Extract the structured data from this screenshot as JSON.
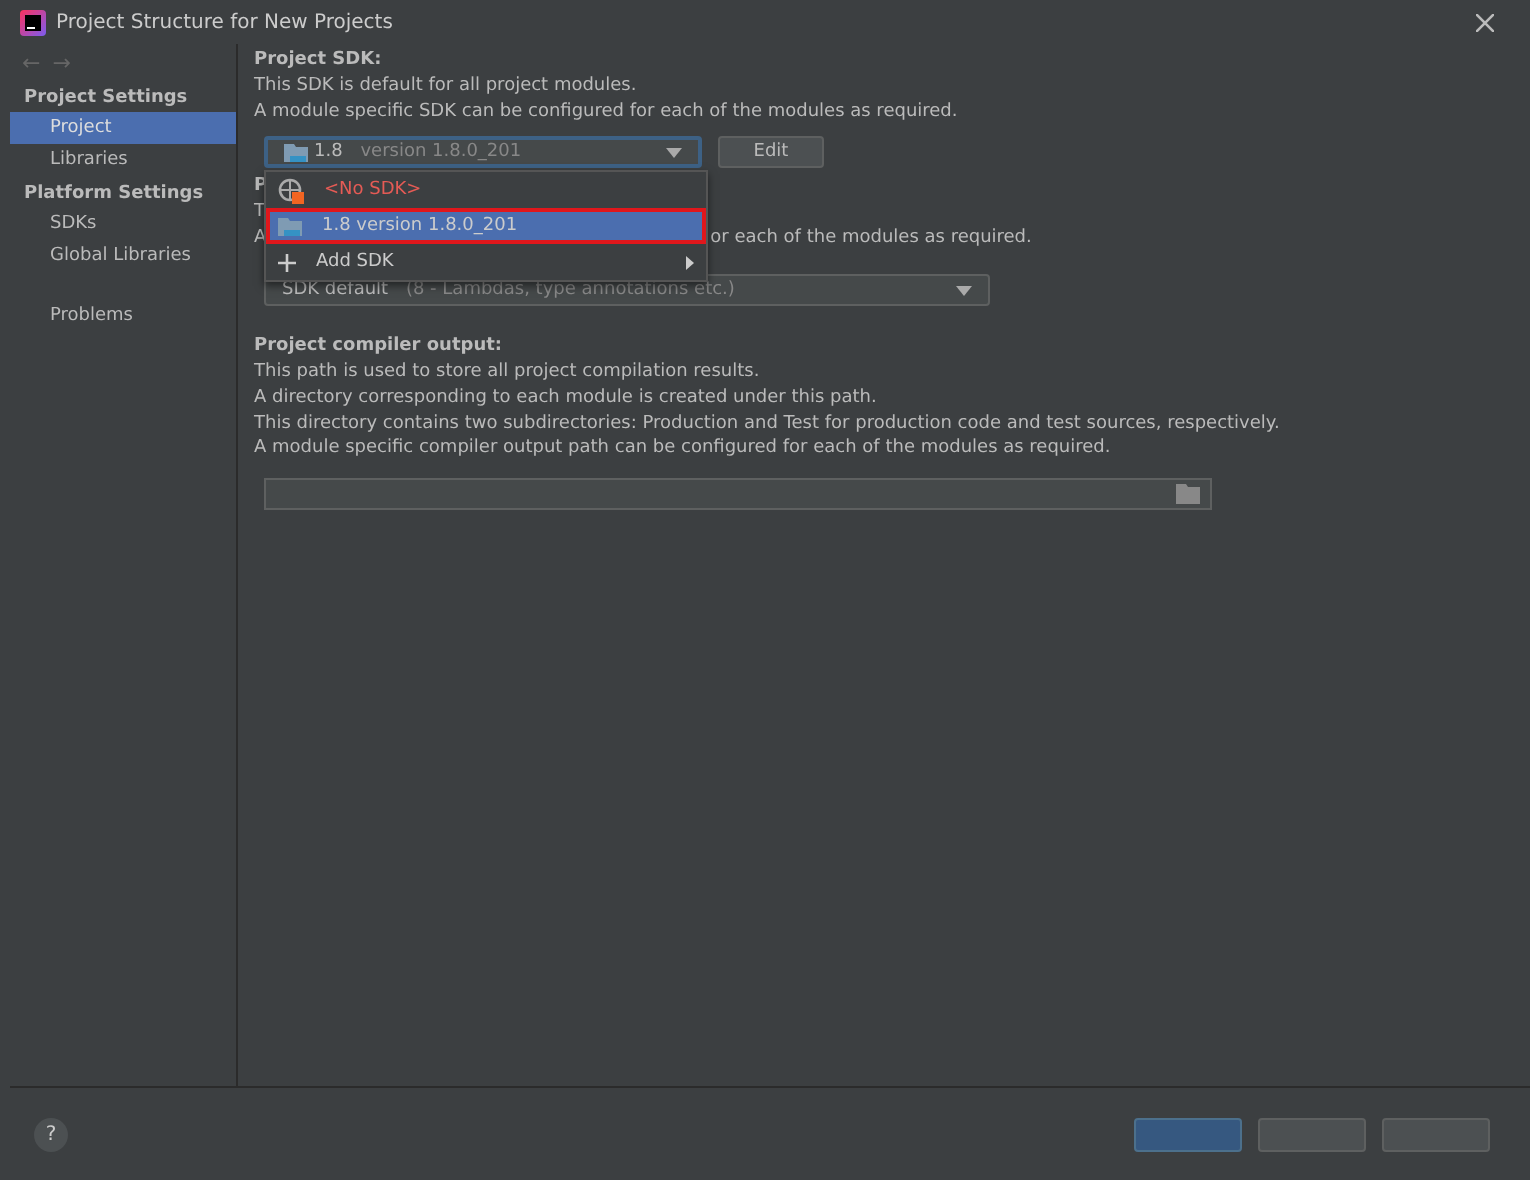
{
  "window": {
    "title": "Project Structure for New Projects"
  },
  "nav": {
    "back": "←",
    "forward": "→"
  },
  "sidebar": {
    "groups": [
      {
        "title": "Project Settings",
        "items": [
          {
            "label": "Project",
            "selected": true
          },
          {
            "label": "Libraries",
            "selected": false
          }
        ]
      },
      {
        "title": "Platform Settings",
        "items": [
          {
            "label": "SDKs",
            "selected": false
          },
          {
            "label": "Global Libraries",
            "selected": false
          }
        ]
      },
      {
        "items": [
          {
            "label": "Problems",
            "selected": false
          }
        ]
      }
    ]
  },
  "project_sdk": {
    "heading": "Project SDK:",
    "lines": [
      "This SDK is default for all project modules.",
      "A module specific SDK can be configured for each of the modules as required."
    ],
    "combo": {
      "name": "1.8",
      "detail": "version 1.8.0_201"
    },
    "edit_button": "Edit"
  },
  "covered_section": {
    "line_1": "P",
    "line_2": "T",
    "line_3_start": "A",
    "line_3_end": "or each of the modules as required.",
    "combo": {
      "name": "SDK default",
      "detail": "(8 - Lambdas, type annotations etc.)"
    }
  },
  "dropdown": {
    "items": [
      {
        "kind": "none",
        "label": "<No SDK>",
        "selected": false
      },
      {
        "kind": "sdk",
        "label": "1.8 version 1.8.0_201",
        "selected": true
      },
      {
        "kind": "add",
        "label": "Add SDK",
        "selected": false
      }
    ]
  },
  "compiler_output": {
    "heading": "Project compiler output:",
    "lines": [
      "This path is used to store all project compilation results.",
      "A directory corresponding to each module is created under this path.",
      "This directory contains two subdirectories: Production and Test for production code and test sources, respectively.",
      "A module specific compiler output path can be configured for each of the modules as required."
    ]
  },
  "footer": {
    "help": "?"
  }
}
